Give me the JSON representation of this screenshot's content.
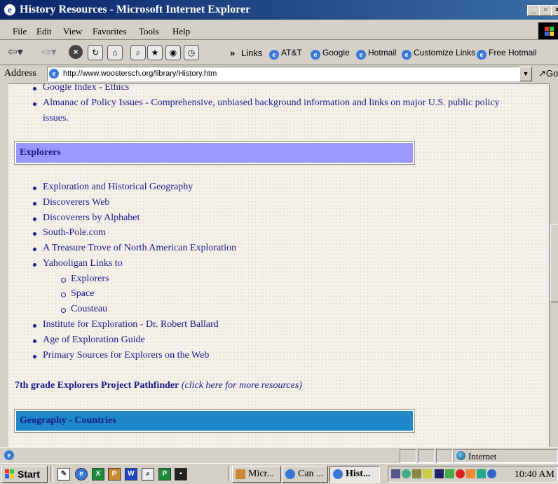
{
  "window": {
    "title": "History Resources - Microsoft Internet Explorer",
    "controls": [
      "_",
      "▫",
      "×"
    ]
  },
  "menu": [
    "File",
    "Edit",
    "View",
    "Favorites",
    "Tools",
    "Help"
  ],
  "links_bar": {
    "chevron": "»",
    "label": "Links",
    "items": [
      "AT&T",
      "Google",
      "Hotmail",
      "Customize Links",
      "Free Hotmail"
    ]
  },
  "address": {
    "label": "Address",
    "url": "http://www.woostersch.org/library/History.htm",
    "go_label": "Go"
  },
  "content": {
    "top_items": [
      "Google Index - Ethics",
      "Almanac of Policy Issues - Comprehensive, unbiased background information and links on major U.S. public policy",
      "issues."
    ],
    "explorers_heading": "Explorers",
    "explorers_items": [
      "Exploration and Historical Geography",
      "Discoverers Web",
      "Discoverers by Alphabet",
      "South-Pole.com",
      "A Treasure Trove of North American Exploration",
      "Yahooligan Links to"
    ],
    "yahooligan_sub": [
      "Explorers",
      "Space",
      "Cousteau"
    ],
    "explorers_items_2": [
      "Institute for Exploration - Dr. Robert Ballard",
      "Age of Exploration Guide",
      "Primary Sources for Explorers on the Web"
    ],
    "pathfinder_link": "7th grade Explorers Project Pathfinder",
    "pathfinder_note": "(click here for more resources)",
    "geography_heading": "Geography - Countries"
  },
  "status": {
    "zone": "Internet"
  },
  "taskbar": {
    "start": "Start",
    "tasks": [
      "Micr...",
      "Can ...",
      "Hist..."
    ],
    "clock": "10:40 AM"
  },
  "colors": {
    "title_bar": "#0a246a",
    "link_text": "#1a1a8c",
    "explorers_heading_bg": "#9999ff",
    "geography_heading_bg": "#1e88c8"
  }
}
